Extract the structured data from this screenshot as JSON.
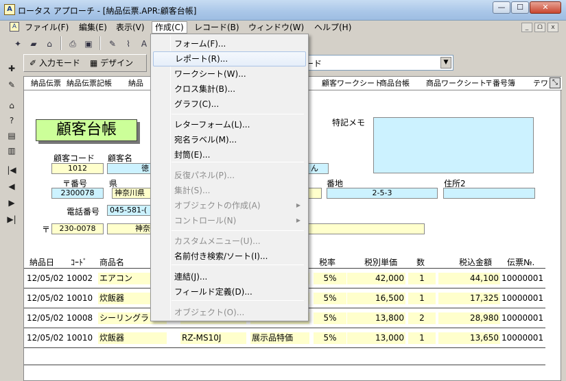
{
  "window": {
    "title": "ロータス アプローチ - [納品伝票.APR:顧客台帳]",
    "minimize": "—",
    "maximize": "☐",
    "close": "✕"
  },
  "menubar": {
    "items": [
      "ファイル(F)",
      "編集(E)",
      "表示(V)",
      "作成(C)",
      "レコード(B)",
      "ウィンドウ(W)",
      "ヘルプ(H)"
    ],
    "mdi": [
      "_",
      "ᗝ",
      "x"
    ]
  },
  "toolbar": {
    "input_mode": "入力モード",
    "design_mode": "デザイン",
    "combo_value": "ード"
  },
  "tabs": [
    "納品伝票",
    "納品伝票記帳",
    "納品",
    "顧客ワークシート",
    "商品台帳",
    "商品ワークシート",
    "〒番号簿",
    "テワ"
  ],
  "form": {
    "title": "顧客台帳",
    "memo_label": "特記メモ",
    "customer_code_label": "顧客コード",
    "customer_code": "1012",
    "customer_name_label": "顧客名",
    "customer_name_visible": "徳",
    "customer_name_tail": "ん",
    "postal_label": "〒番号",
    "postal": "2300078",
    "pref_label": "県",
    "pref": "神奈川県",
    "banchi_label": "番地",
    "banchi": "2-5-3",
    "addr2_label": "住所2",
    "addr2": "",
    "phone_label": "電話番号",
    "phone": "045-581-(",
    "mark": "〒",
    "postal2": "230-0078",
    "address_line": "神奈"
  },
  "grid": {
    "headers": [
      "納品日",
      "ｺｰﾄﾞ",
      "商品名",
      "税率",
      "税別単価",
      "数",
      "税込金額",
      "伝票№."
    ],
    "rows": [
      {
        "date": "12/05/02",
        "code": "10002",
        "name": "エアコン",
        "model": "",
        "note": "",
        "tax": "5%",
        "price": "42,000",
        "qty": "1",
        "total": "44,100",
        "slip": "10000001"
      },
      {
        "date": "12/05/02",
        "code": "10010",
        "name": "炊飯器",
        "model": "",
        "note": "",
        "tax": "5%",
        "price": "16,500",
        "qty": "1",
        "total": "17,325",
        "slip": "10000001"
      },
      {
        "date": "12/05/02",
        "code": "10008",
        "name": "シーリングラ",
        "model": "",
        "note": "",
        "tax": "5%",
        "price": "13,800",
        "qty": "2",
        "total": "28,980",
        "slip": "10000001"
      },
      {
        "date": "12/05/02",
        "code": "10010",
        "name": "炊飯器",
        "model": "RZ-MS10J",
        "note": "展示品特価",
        "tax": "5%",
        "price": "13,000",
        "qty": "1",
        "total": "13,650",
        "slip": "10000001"
      }
    ]
  },
  "dropdown": {
    "items": [
      {
        "label": "フォーム(F)...",
        "enabled": true
      },
      {
        "label": "レポート(R)...",
        "enabled": true,
        "highlighted": true
      },
      {
        "label": "ワークシート(W)...",
        "enabled": true
      },
      {
        "label": "クロス集計(B)...",
        "enabled": true
      },
      {
        "label": "グラフ(C)...",
        "enabled": true
      },
      {
        "label": "レターフォーム(L)...",
        "enabled": true
      },
      {
        "label": "宛名ラベル(M)...",
        "enabled": true
      },
      {
        "label": "封筒(E)...",
        "enabled": true
      },
      {
        "label": "反復パネル(P)...",
        "enabled": false
      },
      {
        "label": "集計(S)...",
        "enabled": false
      },
      {
        "label": "オブジェクトの作成(A)",
        "enabled": false,
        "submenu": true
      },
      {
        "label": "コントロール(N)",
        "enabled": false,
        "submenu": true
      },
      {
        "label": "カスタムメニュー(U)...",
        "enabled": false
      },
      {
        "label": "名前付き検索/ソート(I)...",
        "enabled": true
      },
      {
        "label": "連結(J)...",
        "enabled": true
      },
      {
        "label": "フィールド定義(D)...",
        "enabled": true
      },
      {
        "label": "オブジェクト(O)...",
        "enabled": false
      }
    ],
    "submenu_arrow": "▶"
  },
  "icons": {
    "nav_first": "|◀",
    "nav_prev": "◀",
    "nav_next": "▶",
    "nav_last": "▶|",
    "combo_arrow": "▼"
  }
}
